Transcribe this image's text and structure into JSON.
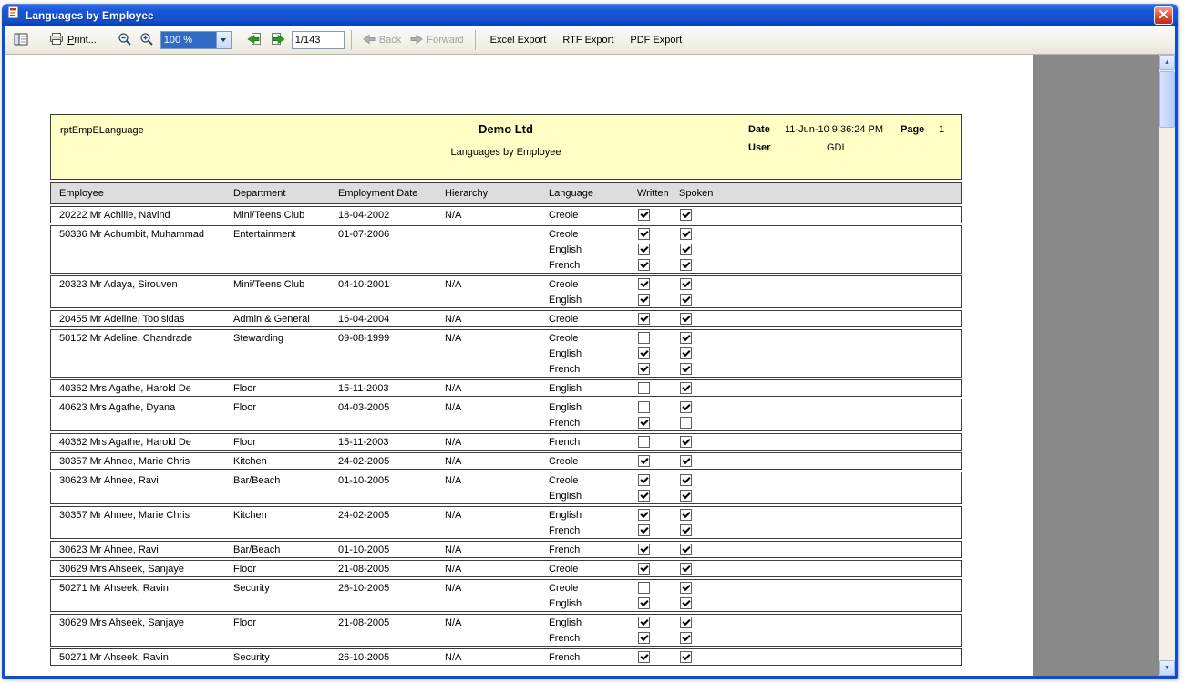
{
  "window": {
    "title": "Languages by Employee"
  },
  "toolbar": {
    "print_label": "Print...",
    "zoom_value": "100 %",
    "page_indicator": "1/143",
    "back_label": "Back",
    "forward_label": "Forward",
    "excel_export": "Excel Export",
    "rtf_export": "RTF Export",
    "pdf_export": "PDF Export"
  },
  "report": {
    "report_id": "rptEmpELanguage",
    "company": "Demo Ltd",
    "subtitle": "Languages by Employee",
    "date_label": "Date",
    "date_value": "11-Jun-10 9:36:24 PM",
    "page_label": "Page",
    "page_value": "1",
    "user_label": "User",
    "user_value": "GDI"
  },
  "colors": {
    "report_header_bg": "#FFFFC6",
    "titlebar_blue": "#1550CE",
    "selection_blue": "#316AC5"
  },
  "table": {
    "headers": [
      "Employee",
      "Department",
      "Employment Date",
      "Hierarchy",
      "Language",
      "Written",
      "Spoken"
    ],
    "groups": [
      {
        "employee": "20222 Mr Achille, Navind",
        "department": "Mini/Teens Club",
        "employment_date": "18-04-2002",
        "hierarchy": "N/A",
        "languages": [
          {
            "name": "Creole",
            "written": true,
            "spoken": true
          }
        ]
      },
      {
        "employee": "50336 Mr Achumbit, Muhammad",
        "department": "Entertainment",
        "employment_date": "01-07-2006",
        "hierarchy": "",
        "languages": [
          {
            "name": "Creole",
            "written": true,
            "spoken": true
          },
          {
            "name": "English",
            "written": true,
            "spoken": true
          },
          {
            "name": "French",
            "written": true,
            "spoken": true
          }
        ]
      },
      {
        "employee": "20323 Mr Adaya, Sirouven",
        "department": "Mini/Teens Club",
        "employment_date": "04-10-2001",
        "hierarchy": "N/A",
        "languages": [
          {
            "name": "Creole",
            "written": true,
            "spoken": true
          },
          {
            "name": "English",
            "written": true,
            "spoken": true
          }
        ]
      },
      {
        "employee": "20455 Mr Adeline, Toolsidas",
        "department": "Admin & General",
        "employment_date": "16-04-2004",
        "hierarchy": "N/A",
        "languages": [
          {
            "name": "Creole",
            "written": true,
            "spoken": true
          }
        ]
      },
      {
        "employee": "50152 Mr Adeline, Chandrade",
        "department": "Stewarding",
        "employment_date": "09-08-1999",
        "hierarchy": "N/A",
        "languages": [
          {
            "name": "Creole",
            "written": false,
            "spoken": true
          },
          {
            "name": "English",
            "written": true,
            "spoken": true
          },
          {
            "name": "French",
            "written": true,
            "spoken": true
          }
        ]
      },
      {
        "employee": "40362 Mrs Agathe, Harold De",
        "department": "Floor",
        "employment_date": "15-11-2003",
        "hierarchy": "N/A",
        "languages": [
          {
            "name": "English",
            "written": false,
            "spoken": true
          }
        ]
      },
      {
        "employee": "40623 Mrs Agathe, Dyana",
        "department": "Floor",
        "employment_date": "04-03-2005",
        "hierarchy": "N/A",
        "languages": [
          {
            "name": "English",
            "written": false,
            "spoken": true
          },
          {
            "name": "French",
            "written": true,
            "spoken": false
          }
        ]
      },
      {
        "employee": "40362 Mrs Agathe, Harold De",
        "department": "Floor",
        "employment_date": "15-11-2003",
        "hierarchy": "N/A",
        "languages": [
          {
            "name": "French",
            "written": false,
            "spoken": true
          }
        ]
      },
      {
        "employee": "30357 Mr Ahnee, Marie Chris",
        "department": "Kitchen",
        "employment_date": "24-02-2005",
        "hierarchy": "N/A",
        "languages": [
          {
            "name": "Creole",
            "written": true,
            "spoken": true
          }
        ]
      },
      {
        "employee": "30623 Mr Ahnee, Ravi",
        "department": "Bar/Beach",
        "employment_date": "01-10-2005",
        "hierarchy": "N/A",
        "languages": [
          {
            "name": "Creole",
            "written": true,
            "spoken": true
          },
          {
            "name": "English",
            "written": true,
            "spoken": true
          }
        ]
      },
      {
        "employee": "30357 Mr Ahnee, Marie Chris",
        "department": "Kitchen",
        "employment_date": "24-02-2005",
        "hierarchy": "N/A",
        "languages": [
          {
            "name": "English",
            "written": true,
            "spoken": true
          },
          {
            "name": "French",
            "written": true,
            "spoken": true
          }
        ]
      },
      {
        "employee": "30623 Mr Ahnee, Ravi",
        "department": "Bar/Beach",
        "employment_date": "01-10-2005",
        "hierarchy": "N/A",
        "languages": [
          {
            "name": "French",
            "written": true,
            "spoken": true
          }
        ]
      },
      {
        "employee": "30629 Mrs Ahseek, Sanjaye",
        "department": "Floor",
        "employment_date": "21-08-2005",
        "hierarchy": "N/A",
        "languages": [
          {
            "name": "Creole",
            "written": true,
            "spoken": true
          }
        ]
      },
      {
        "employee": "50271 Mr Ahseek, Ravin",
        "department": "Security",
        "employment_date": "26-10-2005",
        "hierarchy": "N/A",
        "languages": [
          {
            "name": "Creole",
            "written": false,
            "spoken": true
          },
          {
            "name": "English",
            "written": true,
            "spoken": true
          }
        ]
      },
      {
        "employee": "30629 Mrs Ahseek, Sanjaye",
        "department": "Floor",
        "employment_date": "21-08-2005",
        "hierarchy": "N/A",
        "languages": [
          {
            "name": "English",
            "written": true,
            "spoken": true
          },
          {
            "name": "French",
            "written": true,
            "spoken": true
          }
        ]
      },
      {
        "employee": "50271 Mr Ahseek, Ravin",
        "department": "Security",
        "employment_date": "26-10-2005",
        "hierarchy": "N/A",
        "languages": [
          {
            "name": "French",
            "written": true,
            "spoken": true
          }
        ]
      }
    ]
  }
}
